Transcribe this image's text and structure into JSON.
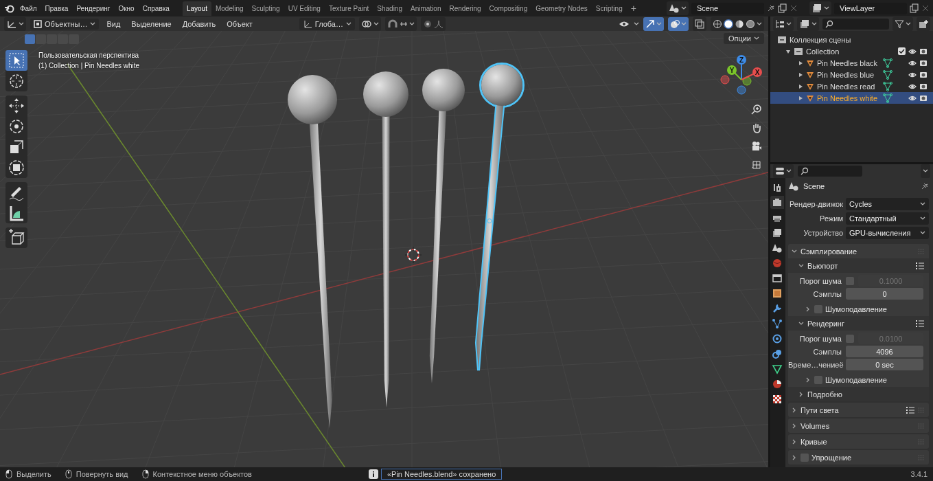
{
  "topbar": {
    "menus": [
      "Файл",
      "Правка",
      "Рендеринг",
      "Окно",
      "Справка"
    ],
    "workspaces": [
      {
        "label": "Layout",
        "selected": true
      },
      {
        "label": "Modeling",
        "selected": false
      },
      {
        "label": "Sculpting",
        "selected": false
      },
      {
        "label": "UV Editing",
        "selected": false
      },
      {
        "label": "Texture Paint",
        "selected": false
      },
      {
        "label": "Shading",
        "selected": false
      },
      {
        "label": "Animation",
        "selected": false
      },
      {
        "label": "Rendering",
        "selected": false
      },
      {
        "label": "Compositing",
        "selected": false
      },
      {
        "label": "Geometry Nodes",
        "selected": false
      },
      {
        "label": "Scripting",
        "selected": false
      }
    ],
    "add_tab": "+",
    "scene": "Scene",
    "view_layer": "ViewLayer"
  },
  "viewport": {
    "mode": "Объектны…",
    "menus": [
      "Вид",
      "Выделение",
      "Добавить",
      "Объект"
    ],
    "orientation": "Глоба…",
    "toggles": [
      {
        "kind": "gizmos",
        "on": true
      },
      {
        "kind": "overlays",
        "on": true
      },
      {
        "kind": "xray",
        "on": false
      }
    ],
    "shading": [
      {
        "kind": "wireframe",
        "selected": false
      },
      {
        "kind": "solid",
        "selected": true
      },
      {
        "kind": "material",
        "selected": false
      },
      {
        "kind": "rendered",
        "selected": false
      }
    ],
    "select_modes": [
      {
        "selected": true
      },
      {
        "selected": false
      },
      {
        "selected": false
      },
      {
        "selected": false
      },
      {
        "selected": false
      }
    ],
    "info": [
      "Пользовательская перспектива",
      "(1) Collection | Pin Needles white"
    ],
    "options": "Опции",
    "tool_groups": [
      {
        "tools": [
          {
            "kind": "select",
            "selected": true
          },
          {
            "kind": "cursor",
            "selected": false
          }
        ]
      },
      {
        "tools": [
          {
            "kind": "move",
            "selected": false
          },
          {
            "kind": "rotate",
            "selected": false
          },
          {
            "kind": "scale",
            "selected": false
          },
          {
            "kind": "transform",
            "selected": false
          }
        ]
      },
      {
        "tools": [
          {
            "kind": "annotate",
            "selected": false
          },
          {
            "kind": "measure",
            "selected": false
          }
        ]
      },
      {
        "tools": [
          {
            "kind": "add_cube",
            "selected": false
          }
        ]
      }
    ],
    "gizmo": [
      {
        "label": "Z",
        "color": "#3d8be6"
      },
      {
        "label": "Y",
        "color": "#7ac52a"
      },
      {
        "label": "X",
        "color": "#e64d4d"
      }
    ]
  },
  "outliner": {
    "root": "Коллекция сцены",
    "collections": [
      {
        "label": "Collection",
        "expanded": true,
        "checked": true,
        "objects": [
          {
            "label": "Pin Needles black",
            "expanded": false,
            "selected": false
          },
          {
            "label": "Pin Needles blue",
            "expanded": false,
            "selected": false
          },
          {
            "label": "Pin Needles read",
            "expanded": false,
            "selected": false
          },
          {
            "label": "Pin Needles white",
            "expanded": false,
            "selected": true
          }
        ]
      }
    ]
  },
  "properties": {
    "tabs": [
      {
        "kind": "tool",
        "selected": false
      },
      {
        "kind": "render",
        "selected": true
      },
      {
        "kind": "output",
        "selected": false
      },
      {
        "kind": "view_layer",
        "selected": false
      },
      {
        "kind": "scene",
        "selected": false
      },
      {
        "kind": "world",
        "selected": false
      },
      {
        "kind": "collection",
        "selected": false
      },
      {
        "kind": "object",
        "selected": false
      },
      {
        "kind": "modifiers",
        "selected": false
      },
      {
        "kind": "particles",
        "selected": false
      },
      {
        "kind": "physics",
        "selected": false
      },
      {
        "kind": "constraints",
        "selected": false
      },
      {
        "kind": "data",
        "selected": false
      },
      {
        "kind": "material",
        "selected": false
      },
      {
        "kind": "texture",
        "selected": false
      }
    ],
    "context": "Scene",
    "fields": [
      {
        "label": "Рендер-движок",
        "value": "Cycles"
      },
      {
        "label": "Режим",
        "value": "Стандартный"
      },
      {
        "label": "Устройство",
        "value": "GPU-вычисления"
      }
    ],
    "panels": [
      {
        "label": "Сэмплирование",
        "expanded": true,
        "children": [
          {
            "label": "Вьюпорт",
            "expanded": true,
            "presets": true,
            "rows": [
              {
                "kind": "check_number",
                "label": "Порог шума",
                "checked": false,
                "value": "0.1000"
              },
              {
                "kind": "number",
                "label": "Сэмплы",
                "value": "0"
              }
            ],
            "children": [
              {
                "label": "Шумоподавление",
                "expanded": false,
                "checked": false
              }
            ]
          },
          {
            "label": "Рендеринг",
            "expanded": true,
            "presets": true,
            "rows": [
              {
                "kind": "check_number",
                "label": "Порог шума",
                "checked": false,
                "value": "0.0100"
              },
              {
                "kind": "number",
                "label": "Сэмплы",
                "value": "4096"
              },
              {
                "kind": "number",
                "label": "Време…чениеё",
                "value": "0 sec"
              }
            ],
            "children": [
              {
                "label": "Шумоподавление",
                "expanded": false,
                "checked": false
              }
            ]
          },
          {
            "label": "Подробно",
            "expanded": false
          }
        ]
      },
      {
        "label": "Пути света",
        "expanded": false,
        "presets": true
      },
      {
        "label": "Volumes",
        "expanded": false
      },
      {
        "label": "Кривые",
        "expanded": false
      },
      {
        "label": "Упрощение",
        "expanded": false,
        "checked": false
      }
    ]
  },
  "status": {
    "hints": [
      {
        "kind": "left",
        "label": "Выделить"
      },
      {
        "kind": "middle",
        "label": "Повернуть вид"
      },
      {
        "kind": "right",
        "label": "Контекстное меню объектов"
      }
    ],
    "message": "«Pin Needles.blend» сохранено",
    "version": "3.4.1"
  }
}
